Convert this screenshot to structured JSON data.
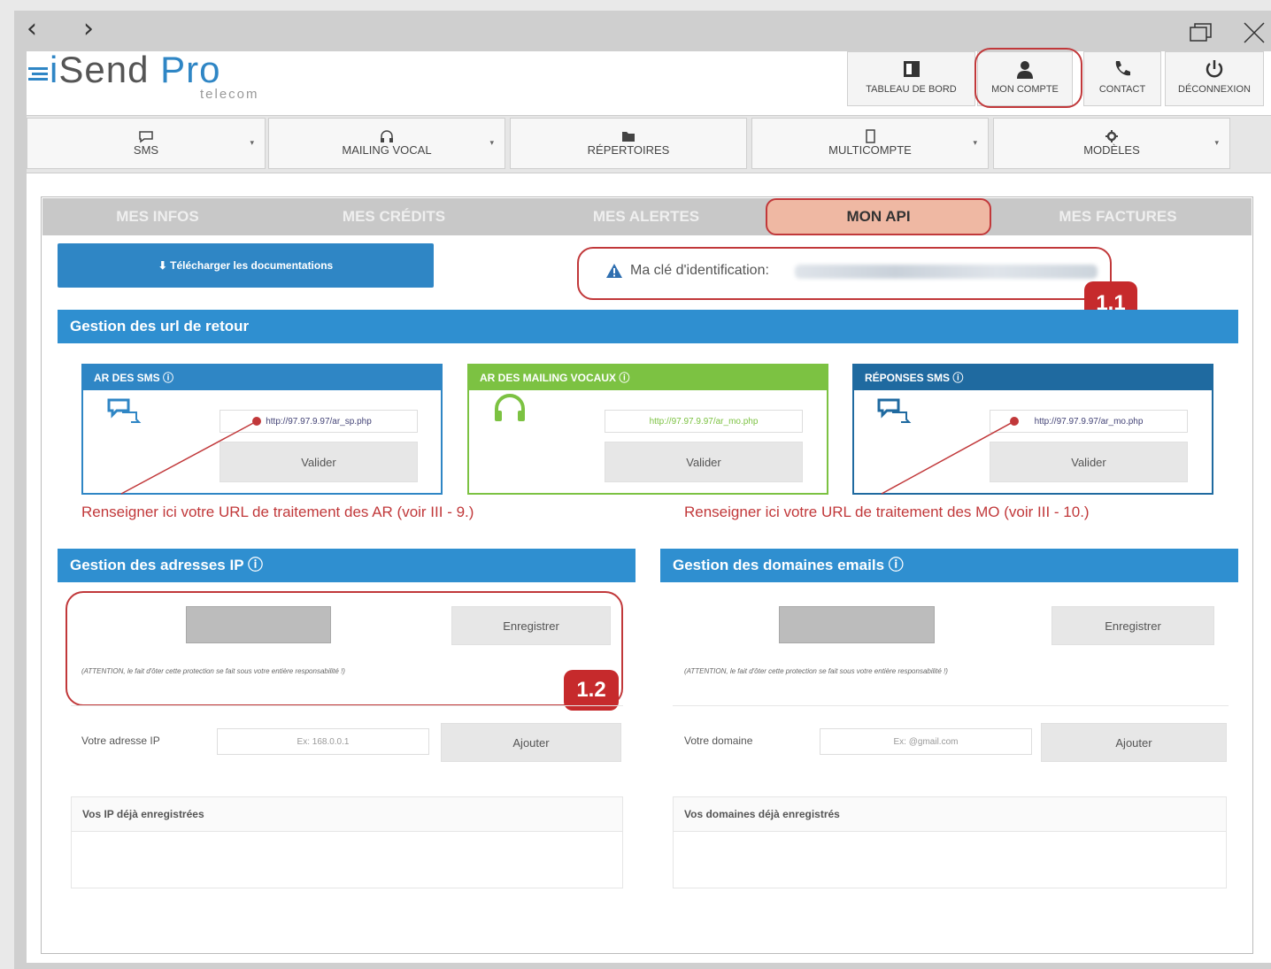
{
  "window": {
    "back_arrow": "‹",
    "forward_arrow": "›",
    "restore_icon": "restore-window-icon",
    "close_icon": "close-icon"
  },
  "logo": {
    "brand_prefix": "i",
    "brand_main": "Send",
    "brand_pro": "Pro",
    "tagline": "telecom"
  },
  "header_buttons": [
    {
      "label": "TABLEAU DE BORD",
      "icon": "dashboard-icon"
    },
    {
      "label": "MON COMPTE",
      "icon": "user-icon"
    },
    {
      "label": "CONTACT",
      "icon": "phone-icon"
    },
    {
      "label": "DÉCONNEXION",
      "icon": "power-icon"
    }
  ],
  "menu": [
    {
      "label": "SMS",
      "icon": "chat-icon"
    },
    {
      "label": "MAILING VOCAL",
      "icon": "headphones-icon"
    },
    {
      "label": "RÉPERTOIRES",
      "icon": "folder-icon"
    },
    {
      "label": "MULTICOMPTE",
      "icon": "tablet-icon"
    },
    {
      "label": "MODÈLES",
      "icon": "gear-icon"
    }
  ],
  "tabs": [
    "MES INFOS",
    "MES CRÉDITS",
    "MES ALERTES",
    "MON API",
    "MES FACTURES"
  ],
  "download_button": "Télécharger les documentations",
  "api_key_label": "Ma clé d'identification:",
  "badges": {
    "b1": "1.1",
    "b2": "1.2"
  },
  "return_urls": {
    "title": "Gestion des url de retour",
    "cards": [
      {
        "title": "AR DES SMS",
        "url": "http://97.97.9.97/ar_sp.php",
        "button": "Valider",
        "color": "#2f86c5"
      },
      {
        "title": "AR DES MAILING VOCAUX",
        "url": "http://97.97.9.97/ar_mo.php",
        "button": "Valider",
        "color": "#7cc242"
      },
      {
        "title": "RÉPONSES SMS",
        "url": "http://97.97.9.97/ar_mo.php",
        "button": "Valider",
        "color": "#1f6aa0"
      }
    ]
  },
  "notes": {
    "ar": "Renseigner ici votre URL de traitement des AR (voir III - 9.)",
    "mo": "Renseigner ici votre URL de traitement des MO (voir III - 10.)"
  },
  "ip": {
    "title": "Gestion des adresses IP",
    "save": "Enregistrer",
    "warning": "(ATTENTION, le fait d'ôter cette protection se fait sous votre entière responsabilité !)",
    "field_label": "Votre adresse IP",
    "placeholder": "Ex: 168.0.0.1",
    "add": "Ajouter",
    "list_title": "Vos IP déjà enregistrées"
  },
  "domains": {
    "title": "Gestion des domaines emails",
    "save": "Enregistrer",
    "warning": "(ATTENTION, le fait d'ôter cette protection se fait sous votre entière responsabilité !)",
    "field_label": "Votre domaine",
    "placeholder": "Ex: @gmail.com",
    "add": "Ajouter",
    "list_title": "Vos domaines déjà enregistrés"
  },
  "colors": {
    "accent_blue": "#2f8fd0",
    "highlight_red": "#c1383a",
    "tab_active": "#efb8a3",
    "green": "#7cc242"
  }
}
